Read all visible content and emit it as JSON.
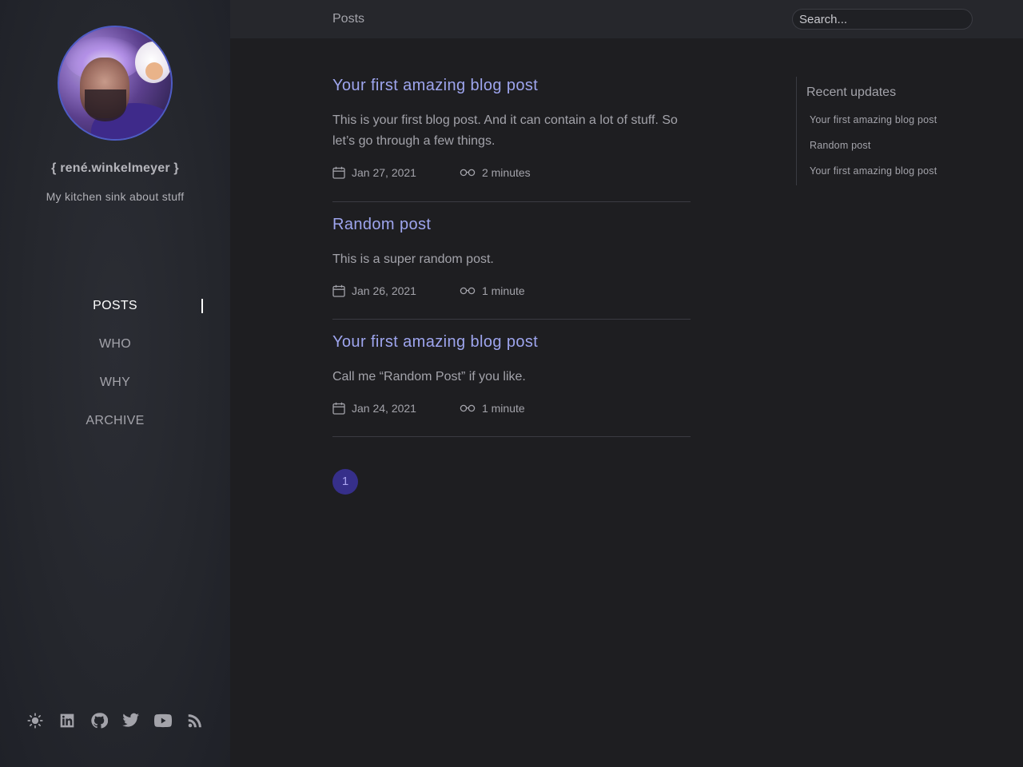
{
  "sidebar": {
    "site_name": "{ rené.winkelmeyer }",
    "tagline": "My kitchen sink about stuff",
    "nav": [
      {
        "label": "POSTS",
        "active": true
      },
      {
        "label": "WHO",
        "active": false
      },
      {
        "label": "WHY",
        "active": false
      },
      {
        "label": "ARCHIVE",
        "active": false
      }
    ],
    "social_icons": [
      "theme-toggle-icon",
      "linkedin-icon",
      "github-icon",
      "twitter-icon",
      "youtube-icon",
      "rss-icon"
    ]
  },
  "topbar": {
    "breadcrumb": "Posts",
    "search_placeholder": "Search..."
  },
  "posts": [
    {
      "title": "Your first amazing blog post",
      "excerpt": "This is your first blog post. And it can contain a lot of stuff. So let’s go through a few things.",
      "date": "Jan 27, 2021",
      "reading_time": "2 minutes"
    },
    {
      "title": "Random post",
      "excerpt": "This is a super random post.",
      "date": "Jan 26, 2021",
      "reading_time": "1 minute"
    },
    {
      "title": "Your first amazing blog post",
      "excerpt": "Call me “Random Post” if you like.",
      "date": "Jan 24, 2021",
      "reading_time": "1 minute"
    }
  ],
  "pagination": {
    "current_page": "1"
  },
  "recent": {
    "title": "Recent updates",
    "items": [
      "Your first amazing blog post",
      "Random post",
      "Your first amazing blog post"
    ]
  },
  "colors": {
    "accent_link": "#9ea5ee",
    "pager_bg": "#362f8a",
    "sidebar_bg": "#25272d",
    "page_bg": "#1e1e21"
  }
}
